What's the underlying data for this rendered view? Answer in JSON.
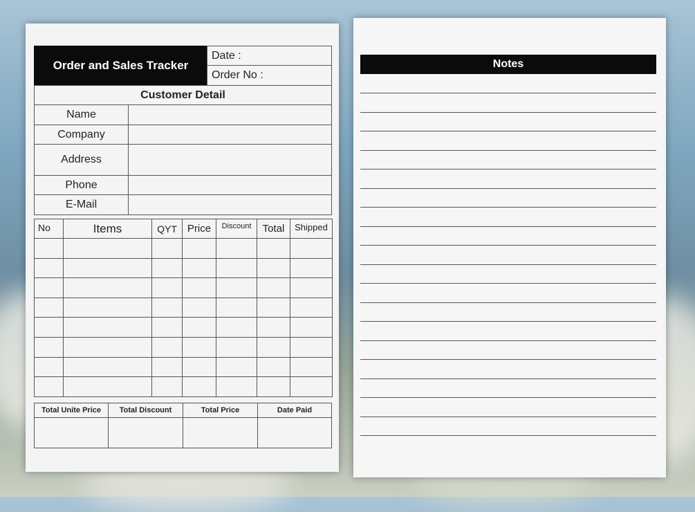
{
  "order_form": {
    "title": "Order and Sales Tracker",
    "date_label": "Date :",
    "order_no_label": "Order No :",
    "customer_heading": "Customer Detail",
    "fields": [
      "Name",
      "Company",
      "Address",
      "Phone",
      "E-Mail"
    ],
    "items_columns": [
      "No",
      "Items",
      "QYT",
      "Price",
      "Discount",
      "Total",
      "Shipped"
    ],
    "empty_item_rows": 8,
    "summary_columns": [
      "Total  Unite Price",
      "Total  Discount",
      "Total  Price",
      "Date Paid"
    ]
  },
  "notes": {
    "heading": "Notes",
    "line_count": 19
  }
}
